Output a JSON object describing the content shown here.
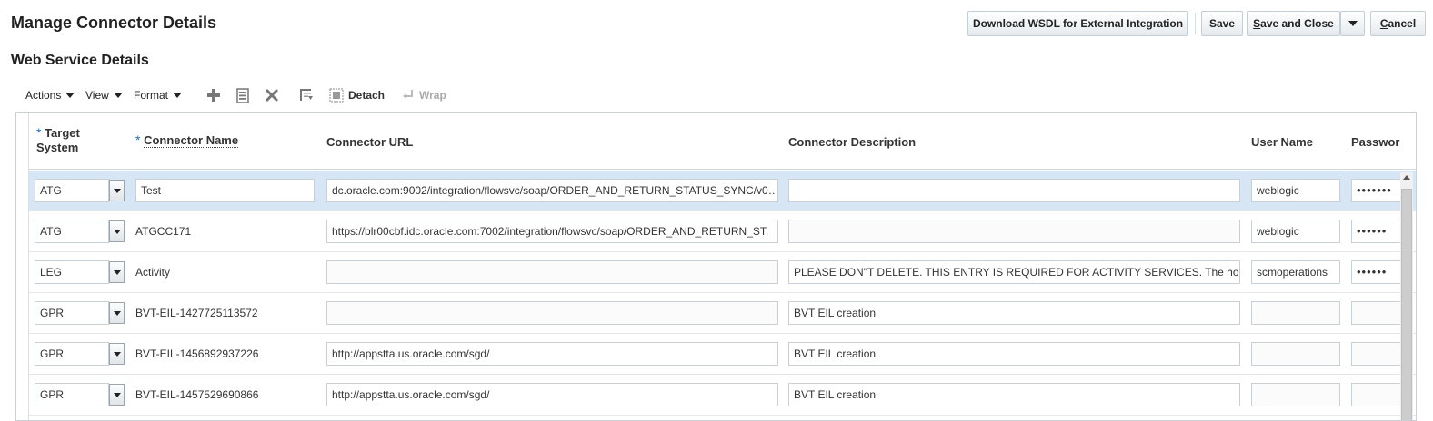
{
  "page_title": "Manage Connector Details",
  "buttons": {
    "download": "Download WSDL for External Integration",
    "save": "Save",
    "save_close_prefix": "S",
    "save_close_rest": "ave and Close",
    "cancel_prefix": "C",
    "cancel_rest": "ancel"
  },
  "section_title": "Web Service Details",
  "toolbar": {
    "actions": "Actions",
    "view": "View",
    "format": "Format",
    "detach": "Detach",
    "wrap": "Wrap",
    "icons": [
      "add-icon",
      "edit-record-icon",
      "delete-icon",
      "freeze-icon",
      "detach-icon",
      "wrap-icon"
    ]
  },
  "table": {
    "columns": {
      "target_system_line1": "Target",
      "target_system_line2": "System",
      "connector_name": "Connector Name",
      "connector_url": "Connector URL",
      "connector_description": "Connector Description",
      "user_name": "User Name",
      "password": "Passwor"
    },
    "rows": [
      {
        "target": "ATG",
        "name": "Test",
        "url": "dc.oracle.com:9002/integration/flowsvc/soap/ORDER_AND_RETURN_STATUS_SYNC/v0…",
        "description": "",
        "user": "weblogic",
        "password": "•••••••"
      },
      {
        "target": "ATG",
        "name": "ATGCC171",
        "url": "https://blr00cbf.idc.oracle.com:7002/integration/flowsvc/soap/ORDER_AND_RETURN_ST.",
        "description": "",
        "user": "weblogic",
        "password": "••••••"
      },
      {
        "target": "LEG",
        "name": "Activity",
        "url": "",
        "description": "PLEASE DON\"T DELETE. THIS ENTRY IS REQUIRED FOR ACTIVITY SERVICES. The hos",
        "user": "scmoperations",
        "password": "••••••"
      },
      {
        "target": "GPR",
        "name": "BVT-EIL-1427725113572",
        "url": "",
        "description": "BVT EIL creation",
        "user": "",
        "password": ""
      },
      {
        "target": "GPR",
        "name": "BVT-EIL-1456892937226",
        "url": "http://appstta.us.oracle.com/sgd/",
        "description": "BVT EIL creation",
        "user": "",
        "password": ""
      },
      {
        "target": "GPR",
        "name": "BVT-EIL-1457529690866",
        "url": "http://appstta.us.oracle.com/sgd/",
        "description": "BVT EIL creation",
        "user": "",
        "password": ""
      }
    ]
  },
  "colors": {
    "selected_row": "#d6e6f5",
    "required_marker": "#1d6fb8",
    "button_border": "#c4ced7"
  }
}
